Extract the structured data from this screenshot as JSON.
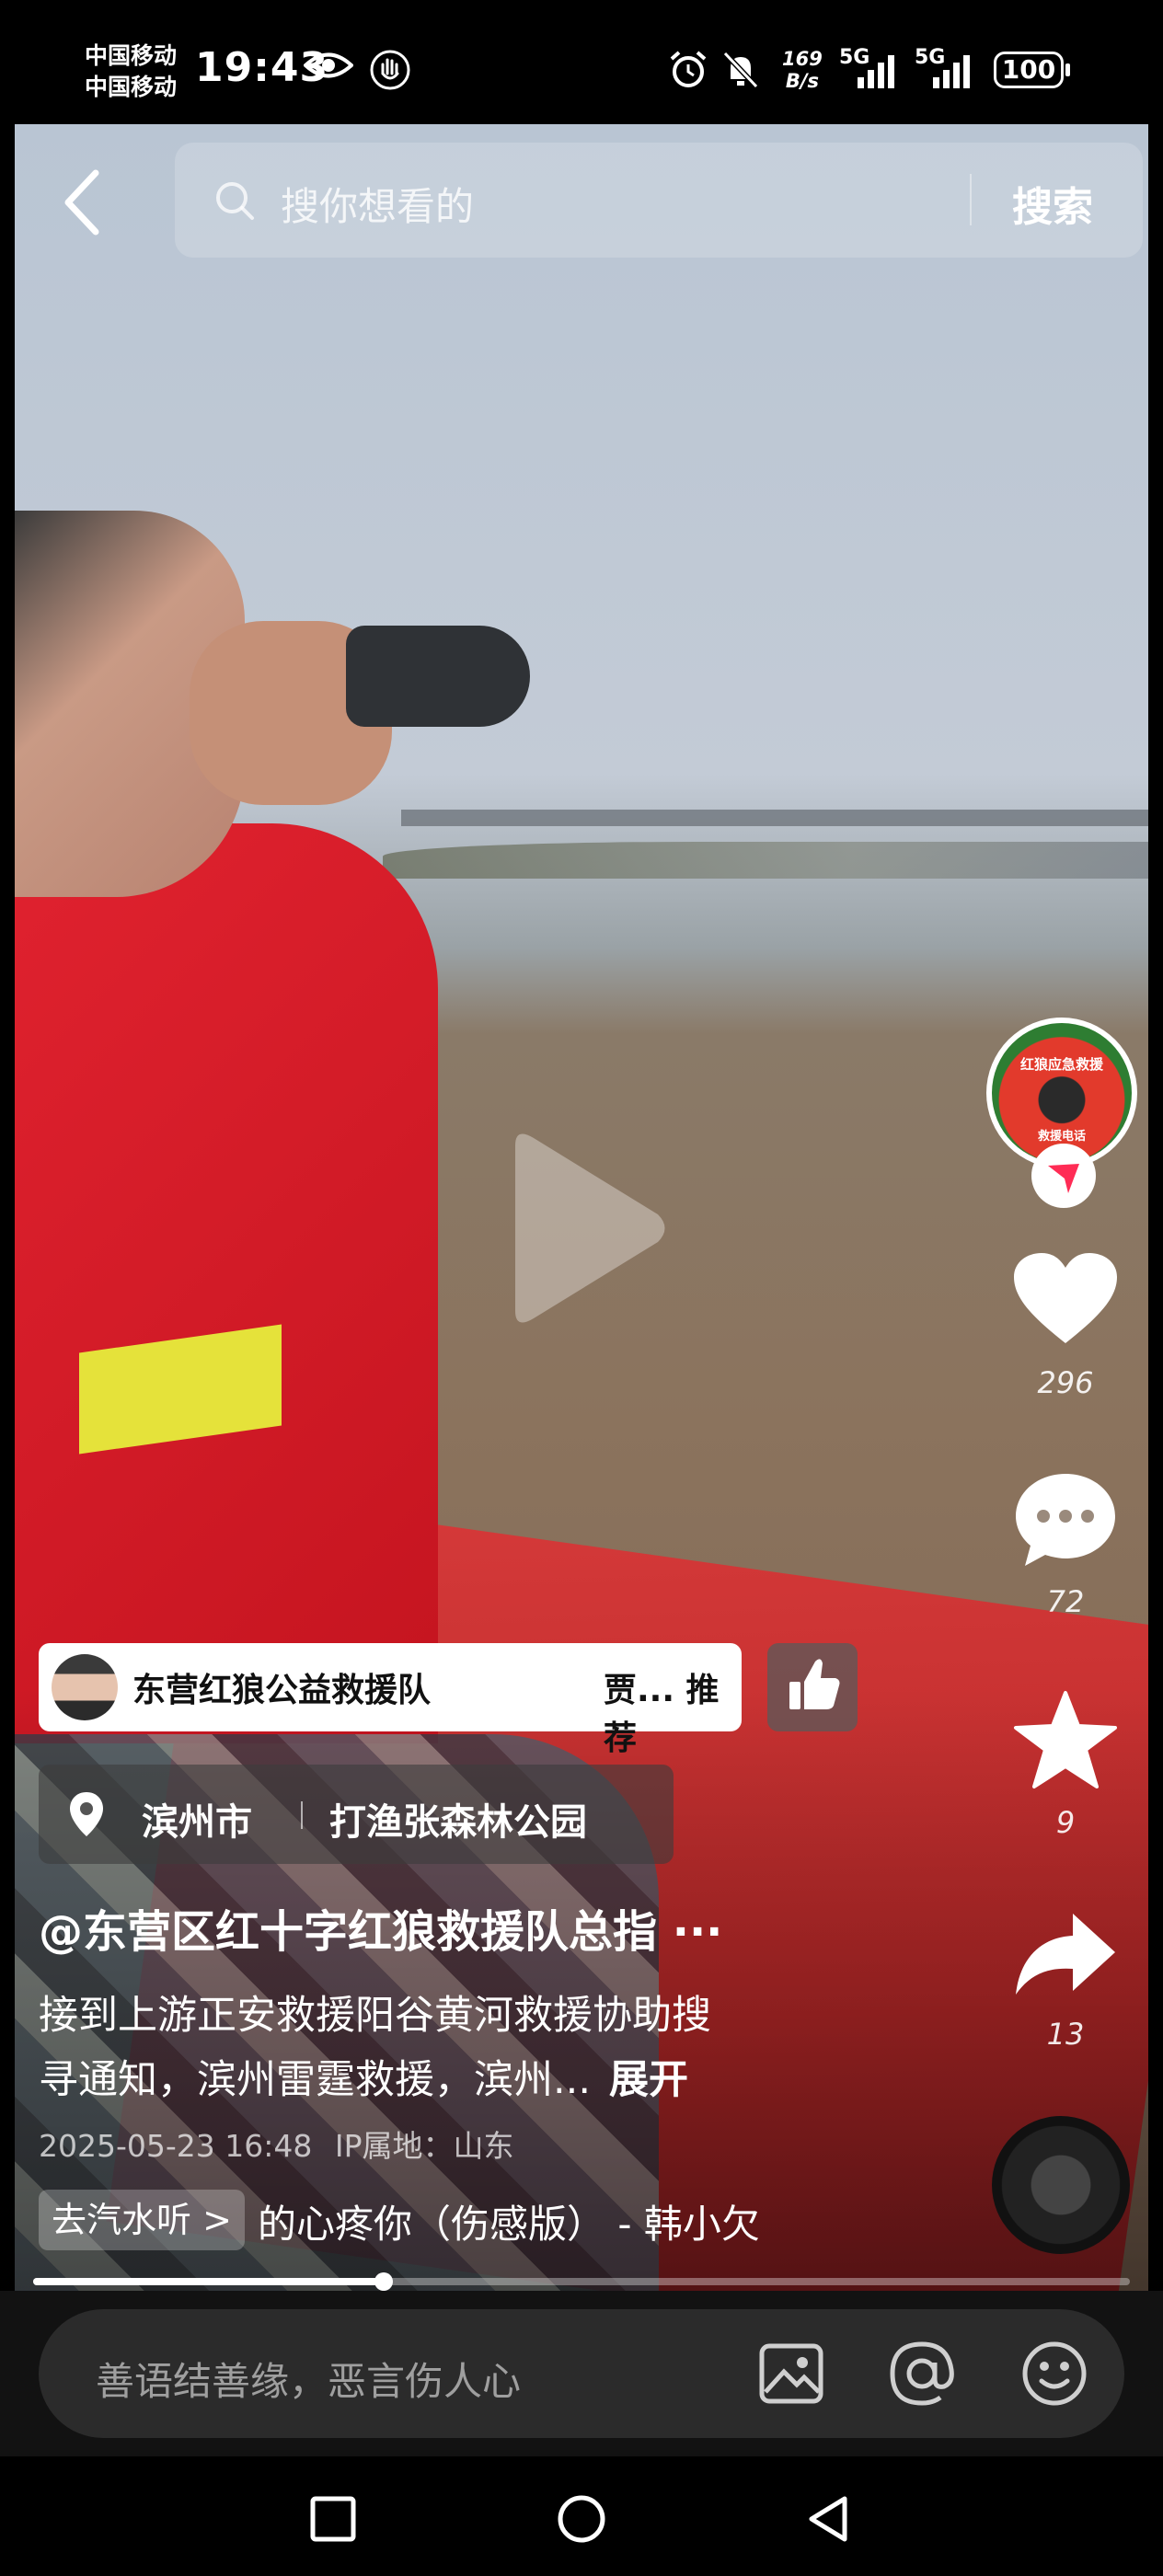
{
  "status_bar": {
    "carrier1": "中国移动",
    "carrier2": "中国移动",
    "time": "19:43",
    "net_speed_value": "169",
    "net_speed_unit": "B/s",
    "network1": "5G",
    "network2": "5G",
    "battery": "100",
    "icons": [
      "eye-icon",
      "hand-icon",
      "alarm-icon",
      "mute-icon",
      "signal-icon"
    ]
  },
  "header": {
    "search_placeholder": "搜你想看的",
    "search_button": "搜索"
  },
  "side_actions": {
    "avatar_text": "红狼应急救援",
    "avatar_sub": "救援电话",
    "likes": "296",
    "comments": "72",
    "favorites": "9",
    "shares": "13"
  },
  "recommend_chip": {
    "title": "东营红狼公益救援队",
    "extra": "贾... 推荐"
  },
  "location": {
    "city": "滨州市",
    "place": "打渔张森林公园"
  },
  "post": {
    "author": "@东营区红十字红狼救援队总指 ···",
    "description_line1": "接到上游正安救援阳谷黄河救援协助搜",
    "description_line2": "寻通知，滨州雷霆救援，滨州...",
    "expand": "展开",
    "date": "2025-05-23 16:48",
    "ip_label": "IP属地：山东"
  },
  "music": {
    "chip_label": "去汽水听 >",
    "title": "的心疼你（伤感版） - 韩小欠"
  },
  "progress": {
    "fraction": 0.32
  },
  "comment_bar": {
    "placeholder": "善语结善缘，恶言伤人心"
  },
  "colors": {
    "accent_red": "#e23a2c",
    "follow_red": "#ff2c55"
  }
}
